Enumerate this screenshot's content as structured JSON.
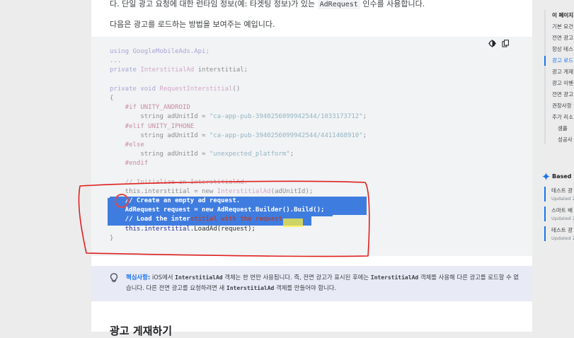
{
  "top_text": {
    "prefix": "다. 단일 광고 요청에 대한 런타임 정보(예: 타겟팅 정보)가 있는 ",
    "code": "AdRequest",
    "suffix": " 인수를 사용합니다."
  },
  "intro_text": "다음은 광고를 로드하는 방법을 보여주는 예입니다.",
  "code_tools": {
    "theme_icon": "dark-mode-icon",
    "copy_icon": "copy-icon"
  },
  "code_lines": {
    "l1": "using GoogleMobileAds.Api;",
    "l2": "...",
    "l3_kw": "private",
    "l3_type": "InterstitialAd",
    "l3_rest": " interstitial;",
    "l5_kw": "private void",
    "l5_fn": "RequestInterstitial",
    "l5_rest": "()",
    "l6": "{",
    "l7": "    #if UNITY_ANDROID",
    "l8_a": "        string adUnitId = ",
    "l8_s": "\"ca-app-pub-3940256099942544/1033173712\"",
    "l8_e": ";",
    "l9": "    #elif UNITY_IPHONE",
    "l10_a": "        string adUnitId = ",
    "l10_s": "\"ca-app-pub-3940256099942544/4411468910\"",
    "l10_e": ";",
    "l11": "    #else",
    "l12_a": "        string adUnitId = ",
    "l12_s": "\"unexpected_platform\"",
    "l12_e": ";",
    "l13": "    #endif",
    "l15": "    // Initialize an InterstitialAd.",
    "l16_a": "    this.interstitial = new ",
    "l16_t": "InterstitialAd",
    "l16_e": "(adUnitId);",
    "l17": "    // Create an empty ad request.",
    "l18": "    AdRequest request = new AdRequest.Builder().Build();",
    "l19_a": "    // Load the inter",
    "l19_b": "stitia",
    "l19_c": "l with the request.",
    "l20_a": "    this.interstitial.",
    "l20_b": "Lo",
    "l20_c": "adAd(request);",
    "l21": "}"
  },
  "note": {
    "label": "핵심사항:",
    "t1": " iOS에서 ",
    "c1": "InterstitialAd",
    "t2": " 객체는 한 번만 사용됩니다. 즉, 전면 광고가 표시된 후에는 ",
    "c2": "InterstitialAd",
    "t3": " 객체를 사용해 다른 광고를 로드할 수 없습니다. 다른 전면 광고를 요청하려면 새 ",
    "c3": "InterstitialAd",
    "t4": " 객체를 만들어야 합니다."
  },
  "section_heading": "광고 게재하기",
  "toc": {
    "title": "이 페이지",
    "items": [
      "기본 요건",
      "전면 광고",
      "항상 테스",
      "광고 로드",
      "광고 게재",
      "광고 이벤",
      "전면 광고",
      "권장사항",
      "추가 리소"
    ],
    "subitems": [
      "샘플",
      "성공사"
    ],
    "active_index": 3
  },
  "based_on": {
    "label": "Based"
  },
  "related": [
    {
      "title": "테스트 광",
      "date": "Updated 2"
    },
    {
      "title": "스마트 배",
      "date": "Updated 2"
    },
    {
      "title": "테스트 광",
      "date": "Updated 2"
    }
  ],
  "colors": {
    "accent": "#1a73e8",
    "selection": "#3f7ce0",
    "annotation": "#e02020",
    "note_bg": "#e8eaf6"
  }
}
